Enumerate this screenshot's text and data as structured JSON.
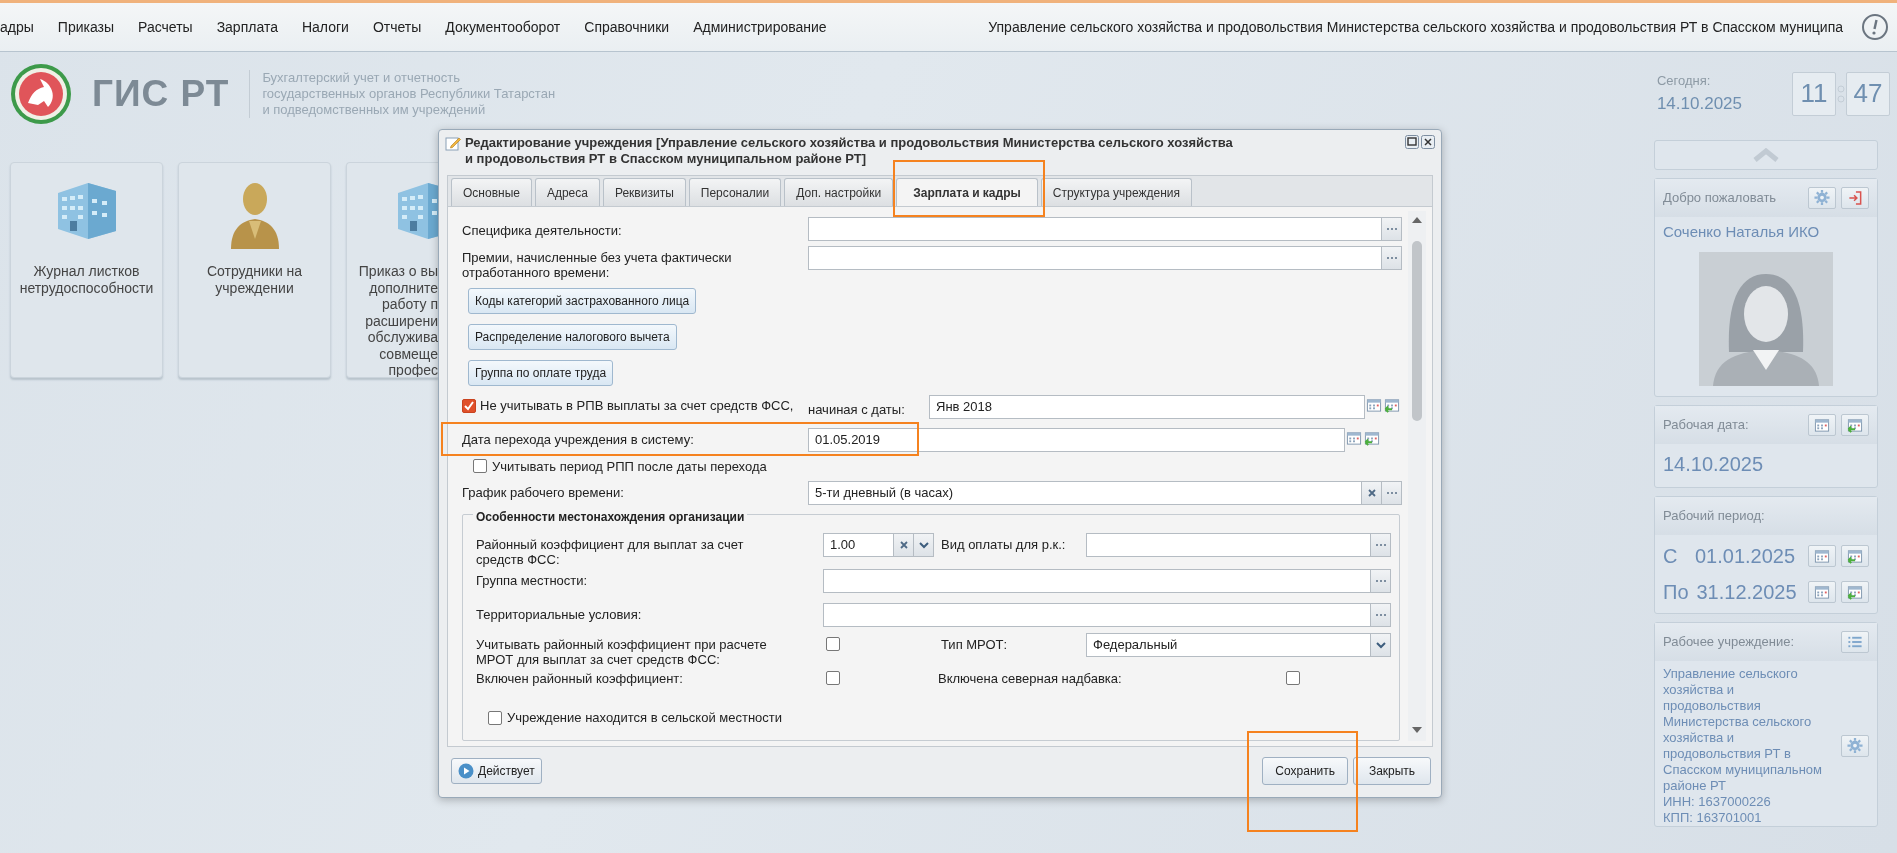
{
  "top_menu": {
    "items": [
      "адры",
      "Приказы",
      "Расчеты",
      "Зарплата",
      "Налоги",
      "Отчеты",
      "Документооборот",
      "Справочники",
      "Администрирование"
    ],
    "organization": "Управление сельского хозяйства и продовольствия Министерства сельского хозяйства и продовольствия РТ в Спасском муниципа"
  },
  "header": {
    "title": "ГИС РТ",
    "subtitle": [
      "Бухгалтерский учет и отчетность",
      "государственных органов Республики Татарстан",
      "и подведомственных им учреждений"
    ],
    "today_label": "Сегодня:",
    "today": "14.10.2025",
    "hours": "11",
    "minutes": "47"
  },
  "tiles": [
    {
      "kind": "building",
      "lines": [
        "Журнал листков",
        "нетрудоспособности"
      ]
    },
    {
      "kind": "person",
      "lines": [
        "Сотрудники на",
        "учреждении"
      ]
    },
    {
      "kind": "building",
      "lines": [
        "Приказ о вы",
        "дополните",
        "работу п",
        "расширени",
        "обслужива",
        "совмеще",
        "профес"
      ]
    }
  ],
  "dialog": {
    "title": "Редактирование учреждения [Управление сельского хозяйства и продовольствия Министерства сельского хозяйства и продовольствия РТ в Спасском муниципальном районе РТ]",
    "tabs": [
      {
        "label": "Основные",
        "selected": false,
        "highlighted": false
      },
      {
        "label": "Адреса",
        "selected": false,
        "highlighted": false
      },
      {
        "label": "Реквизиты",
        "selected": false,
        "highlighted": false
      },
      {
        "label": "Персоналии",
        "selected": false,
        "highlighted": false
      },
      {
        "label": "Доп. настройки",
        "selected": false,
        "highlighted": false
      },
      {
        "label": "Зарплата и кадры",
        "selected": true,
        "highlighted": true
      },
      {
        "label": "Структура учреждения",
        "selected": false,
        "highlighted": false
      }
    ],
    "form": [
      {
        "kind": "lookup",
        "label": "Специфика деятельности:"
      },
      {
        "kind": "lookup",
        "label": "Премии, начисленные без учета фактически отработанного времени:"
      },
      {
        "kind": "button",
        "label": "Коды категорий застрахованного лица"
      },
      {
        "kind": "button",
        "label": "Распределение налогового вычета"
      },
      {
        "kind": "button",
        "label": "Группа по оплате труда"
      },
      {
        "kind": "check_date",
        "label": "Не учитывать в РПВ выплаты за счет средств ФСС,",
        "checked": true,
        "date_label": "начиная с даты:",
        "value": "Янв 2018"
      },
      {
        "kind": "date",
        "label": "Дата перехода учреждения в систему:",
        "value": "01.05.2019",
        "highlighted": true
      },
      {
        "kind": "checkbox",
        "label": "Учитывать период РПП после даты перехода",
        "checked": false
      },
      {
        "kind": "select",
        "label": "График рабочего времени:",
        "value": "5-ти дневный (в часах)"
      }
    ],
    "location": {
      "legend": "Особенности местонахождения организации",
      "district_coef": {
        "label": "Районный коэффициент для выплат за счет средств ФСС:",
        "value": "1.00"
      },
      "pay_type": {
        "label": "Вид оплаты для р.к.:"
      },
      "area_group": {
        "label": "Группа местности:"
      },
      "territorial": {
        "label": "Территориальные условия:"
      },
      "mrot_coef": {
        "label": "Учитывать районный коэффициент при расчете МРОТ для выплат за счет средств ФСС:",
        "checked": false
      },
      "mrot_type": {
        "label": "Тип МРОТ:",
        "value": "Федеральный"
      },
      "coef_on": {
        "label": "Включен районный коэффициент:",
        "checked": false
      },
      "north": {
        "label": "Включена северная надбавка:",
        "checked": false
      },
      "rural": {
        "label": "Учреждение находится в сельской местности",
        "checked": false
      }
    },
    "footer": {
      "status": "Действует",
      "buttons": [
        {
          "label": "Сохранить",
          "highlighted": true
        },
        {
          "label": "Закрыть",
          "highlighted": false
        }
      ]
    }
  },
  "sidebar": {
    "welcome": {
      "title": "Добро пожаловать",
      "user": "Соченко Наталья ИКО"
    },
    "work_date": {
      "title": "Рабочая дата:",
      "value": "14.10.2025"
    },
    "period": {
      "title": "Рабочий период:",
      "from_label": "С",
      "from": "01.01.2025",
      "to_label": "По",
      "to": "31.12.2025"
    },
    "institution": {
      "title": "Рабочее учреждение:",
      "name": "Управление сельского хозяйства и продовольствия Министерства сельского хозяйства и продовольствия РТ в Спасском муниципальном районе РТ",
      "inn": "ИНН: 1637000226",
      "kpp": "КПП: 163701001"
    }
  }
}
